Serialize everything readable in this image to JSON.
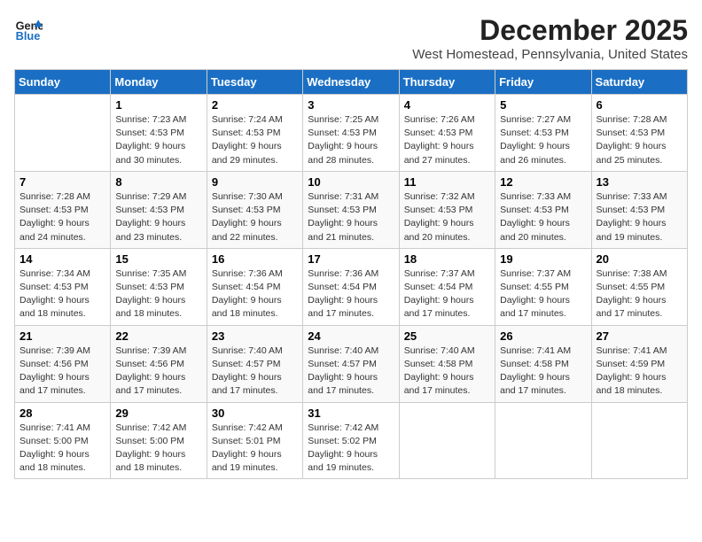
{
  "logo": {
    "line1": "General",
    "line2": "Blue"
  },
  "title": "December 2025",
  "location": "West Homestead, Pennsylvania, United States",
  "days_of_week": [
    "Sunday",
    "Monday",
    "Tuesday",
    "Wednesday",
    "Thursday",
    "Friday",
    "Saturday"
  ],
  "weeks": [
    [
      {
        "num": "",
        "empty": true
      },
      {
        "num": "1",
        "sunrise": "7:23 AM",
        "sunset": "4:53 PM",
        "daylight": "9 hours and 30 minutes."
      },
      {
        "num": "2",
        "sunrise": "7:24 AM",
        "sunset": "4:53 PM",
        "daylight": "9 hours and 29 minutes."
      },
      {
        "num": "3",
        "sunrise": "7:25 AM",
        "sunset": "4:53 PM",
        "daylight": "9 hours and 28 minutes."
      },
      {
        "num": "4",
        "sunrise": "7:26 AM",
        "sunset": "4:53 PM",
        "daylight": "9 hours and 27 minutes."
      },
      {
        "num": "5",
        "sunrise": "7:27 AM",
        "sunset": "4:53 PM",
        "daylight": "9 hours and 26 minutes."
      },
      {
        "num": "6",
        "sunrise": "7:28 AM",
        "sunset": "4:53 PM",
        "daylight": "9 hours and 25 minutes."
      }
    ],
    [
      {
        "num": "7",
        "sunrise": "7:28 AM",
        "sunset": "4:53 PM",
        "daylight": "9 hours and 24 minutes."
      },
      {
        "num": "8",
        "sunrise": "7:29 AM",
        "sunset": "4:53 PM",
        "daylight": "9 hours and 23 minutes."
      },
      {
        "num": "9",
        "sunrise": "7:30 AM",
        "sunset": "4:53 PM",
        "daylight": "9 hours and 22 minutes."
      },
      {
        "num": "10",
        "sunrise": "7:31 AM",
        "sunset": "4:53 PM",
        "daylight": "9 hours and 21 minutes."
      },
      {
        "num": "11",
        "sunrise": "7:32 AM",
        "sunset": "4:53 PM",
        "daylight": "9 hours and 20 minutes."
      },
      {
        "num": "12",
        "sunrise": "7:33 AM",
        "sunset": "4:53 PM",
        "daylight": "9 hours and 20 minutes."
      },
      {
        "num": "13",
        "sunrise": "7:33 AM",
        "sunset": "4:53 PM",
        "daylight": "9 hours and 19 minutes."
      }
    ],
    [
      {
        "num": "14",
        "sunrise": "7:34 AM",
        "sunset": "4:53 PM",
        "daylight": "9 hours and 18 minutes."
      },
      {
        "num": "15",
        "sunrise": "7:35 AM",
        "sunset": "4:53 PM",
        "daylight": "9 hours and 18 minutes."
      },
      {
        "num": "16",
        "sunrise": "7:36 AM",
        "sunset": "4:54 PM",
        "daylight": "9 hours and 18 minutes."
      },
      {
        "num": "17",
        "sunrise": "7:36 AM",
        "sunset": "4:54 PM",
        "daylight": "9 hours and 17 minutes."
      },
      {
        "num": "18",
        "sunrise": "7:37 AM",
        "sunset": "4:54 PM",
        "daylight": "9 hours and 17 minutes."
      },
      {
        "num": "19",
        "sunrise": "7:37 AM",
        "sunset": "4:55 PM",
        "daylight": "9 hours and 17 minutes."
      },
      {
        "num": "20",
        "sunrise": "7:38 AM",
        "sunset": "4:55 PM",
        "daylight": "9 hours and 17 minutes."
      }
    ],
    [
      {
        "num": "21",
        "sunrise": "7:39 AM",
        "sunset": "4:56 PM",
        "daylight": "9 hours and 17 minutes."
      },
      {
        "num": "22",
        "sunrise": "7:39 AM",
        "sunset": "4:56 PM",
        "daylight": "9 hours and 17 minutes."
      },
      {
        "num": "23",
        "sunrise": "7:40 AM",
        "sunset": "4:57 PM",
        "daylight": "9 hours and 17 minutes."
      },
      {
        "num": "24",
        "sunrise": "7:40 AM",
        "sunset": "4:57 PM",
        "daylight": "9 hours and 17 minutes."
      },
      {
        "num": "25",
        "sunrise": "7:40 AM",
        "sunset": "4:58 PM",
        "daylight": "9 hours and 17 minutes."
      },
      {
        "num": "26",
        "sunrise": "7:41 AM",
        "sunset": "4:58 PM",
        "daylight": "9 hours and 17 minutes."
      },
      {
        "num": "27",
        "sunrise": "7:41 AM",
        "sunset": "4:59 PM",
        "daylight": "9 hours and 18 minutes."
      }
    ],
    [
      {
        "num": "28",
        "sunrise": "7:41 AM",
        "sunset": "5:00 PM",
        "daylight": "9 hours and 18 minutes."
      },
      {
        "num": "29",
        "sunrise": "7:42 AM",
        "sunset": "5:00 PM",
        "daylight": "9 hours and 18 minutes."
      },
      {
        "num": "30",
        "sunrise": "7:42 AM",
        "sunset": "5:01 PM",
        "daylight": "9 hours and 19 minutes."
      },
      {
        "num": "31",
        "sunrise": "7:42 AM",
        "sunset": "5:02 PM",
        "daylight": "9 hours and 19 minutes."
      },
      {
        "num": "",
        "empty": true
      },
      {
        "num": "",
        "empty": true
      },
      {
        "num": "",
        "empty": true
      }
    ]
  ]
}
